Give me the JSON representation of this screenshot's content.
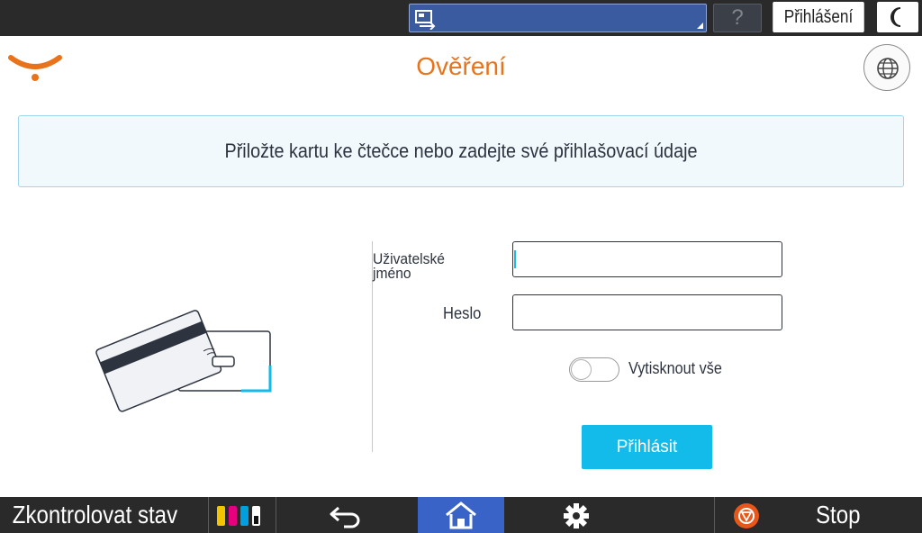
{
  "topbar": {
    "selector_icon": "remote-connect-icon",
    "help_label": "?",
    "login_label": "Přihlášení",
    "night_icon": "moon-icon"
  },
  "header": {
    "logo_icon": "brand-smile-logo",
    "title": "Ověření",
    "language_icon": "globe-icon"
  },
  "banner": {
    "message": "Přiložte kartu ke čtečce nebo zadejte své přihlašovací údaje"
  },
  "illustration": {
    "icon": "card-reader-illustration"
  },
  "form": {
    "username_label": "Uživatelské jméno",
    "username_value": "",
    "password_label": "Heslo",
    "password_value": "",
    "print_all_label": "Vytisknout vše",
    "print_all_on": false,
    "submit_label": "Přihlásit"
  },
  "bottombar": {
    "status_label": "Zkontrolovat stav",
    "toner_icon": "toner-levels-icon",
    "back_icon": "back-arrow-icon",
    "home_icon": "home-icon",
    "settings_icon": "gear-icon",
    "stop_icon": "stop-icon",
    "stop_label": "Stop"
  },
  "colors": {
    "accent_orange": "#e8731a",
    "accent_cyan": "#12bbe9",
    "bar_dark": "#2a2a2a",
    "home_blue": "#3a63c8",
    "selector_blue": "#3a5ba0"
  }
}
